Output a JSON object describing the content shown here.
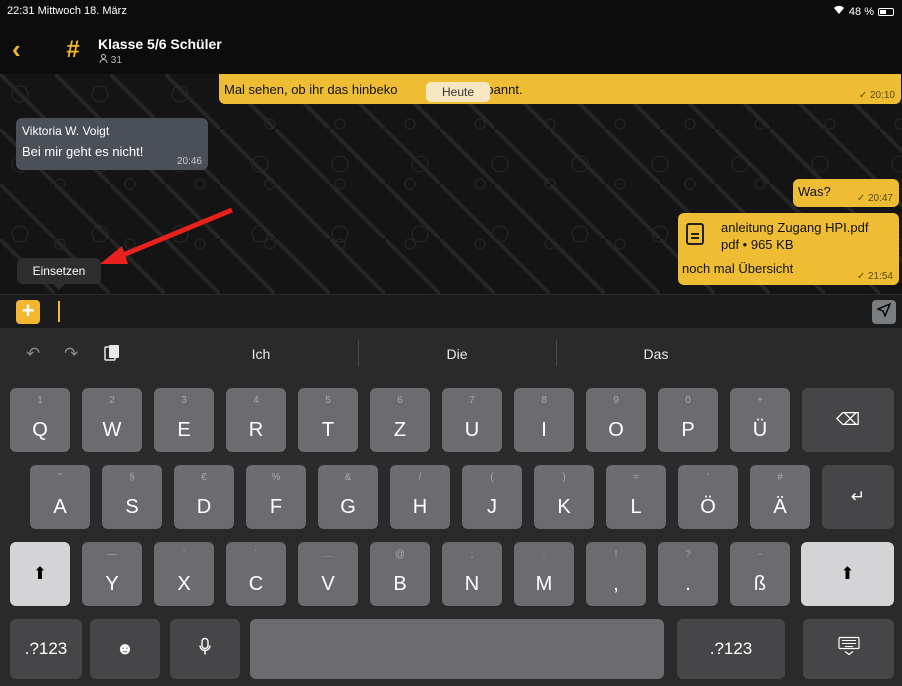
{
  "status": {
    "time_date": "22:31  Mittwoch 18. März",
    "battery": "48 %"
  },
  "header": {
    "back_icon": "chevron-left-icon",
    "channel_icon": "#",
    "title": "Klasse 5/6 Schüler",
    "members": "31"
  },
  "chat": {
    "date_pill": "Heute",
    "messages": [
      {
        "id": "m1",
        "text": "Mal sehen, ob ihr das hinbekommt, bin gespannt.",
        "text_visible_before": "Mal sehen, ob ihr das hinbeko",
        "text_visible_after": "gespannt.",
        "time": "✓ 20:10",
        "own": true
      },
      {
        "id": "m2",
        "sender": "Viktoria W. Voigt",
        "text": "Bei mir geht es nicht!",
        "time": "20:46",
        "own": false
      },
      {
        "id": "m3",
        "text": "Was?",
        "time": "✓ 20:47",
        "own": true
      },
      {
        "id": "m4",
        "file_name": "anleitung Zugang HPI.pdf",
        "file_meta": "pdf • 965 KB",
        "text": "noch mal Übersicht",
        "time": "✓ 21:54",
        "own": true
      }
    ],
    "context_menu": "Einsetzen"
  },
  "input": {
    "placeholder": "",
    "plus_label": "+",
    "send_icon": "paper-plane-icon"
  },
  "keyboard": {
    "suggestions": [
      "Ich",
      "Die",
      "Das"
    ],
    "row1": [
      {
        "sec": "1",
        "pri": "Q"
      },
      {
        "sec": "2",
        "pri": "W"
      },
      {
        "sec": "3",
        "pri": "E"
      },
      {
        "sec": "4",
        "pri": "R"
      },
      {
        "sec": "5",
        "pri": "T"
      },
      {
        "sec": "6",
        "pri": "Z"
      },
      {
        "sec": "7",
        "pri": "U"
      },
      {
        "sec": "8",
        "pri": "I"
      },
      {
        "sec": "9",
        "pri": "O"
      },
      {
        "sec": "0",
        "pri": "P"
      },
      {
        "sec": "+",
        "pri": "Ü"
      }
    ],
    "row2": [
      {
        "sec": "\"",
        "pri": "A"
      },
      {
        "sec": "§",
        "pri": "S"
      },
      {
        "sec": "€",
        "pri": "D"
      },
      {
        "sec": "%",
        "pri": "F"
      },
      {
        "sec": "&",
        "pri": "G"
      },
      {
        "sec": "/",
        "pri": "H"
      },
      {
        "sec": "(",
        "pri": "J"
      },
      {
        "sec": ")",
        "pri": "K"
      },
      {
        "sec": "=",
        "pri": "L"
      },
      {
        "sec": "'",
        "pri": "Ö"
      },
      {
        "sec": "#",
        "pri": "Ä"
      }
    ],
    "row3": [
      {
        "sec": "—",
        "pri": "Y"
      },
      {
        "sec": "`",
        "pri": "X"
      },
      {
        "sec": "´",
        "pri": "C"
      },
      {
        "sec": "…",
        "pri": "V"
      },
      {
        "sec": "@",
        "pri": "B"
      },
      {
        "sec": ";",
        "pri": "N"
      },
      {
        "sec": ":",
        "pri": "M"
      },
      {
        "sec": "!",
        "pri": ","
      },
      {
        "sec": "?",
        "pri": "."
      },
      {
        "sec": "-",
        "pri": "ß"
      }
    ],
    "numbers_label": ".?123",
    "backspace_icon": "backspace-icon",
    "return_icon": "return-icon",
    "shift_icon": "shift-icon",
    "emoji_icon": "emoji-icon",
    "mic_icon": "microphone-icon",
    "hide_keyboard_icon": "keyboard-dismiss-icon"
  }
}
